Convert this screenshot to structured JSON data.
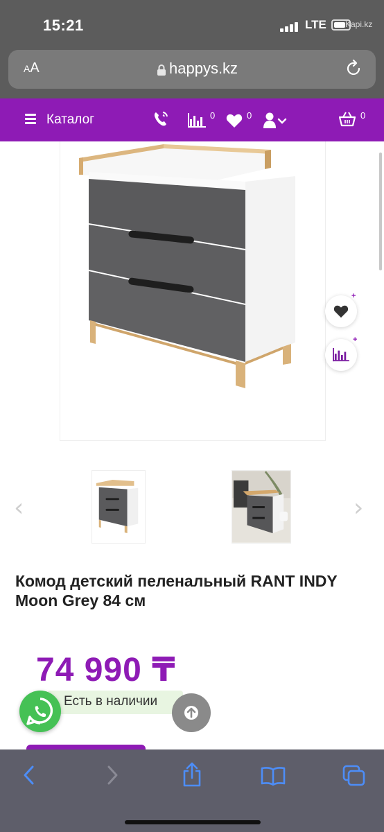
{
  "status_bar": {
    "time": "15:21",
    "network": "LTE",
    "watermark": "Kapi.kz"
  },
  "browser": {
    "text_size_label_small": "A",
    "text_size_label_large": "A",
    "url": "happys.kz"
  },
  "header": {
    "catalog_label": "Каталог",
    "compare_count": "0",
    "wishlist_count": "0",
    "cart_count": "0",
    "accent_color": "#8e1bb5"
  },
  "product": {
    "title": "Комод детский пеленальный RANT INDY Moon Grey 84 см",
    "price": "74 990 ₸",
    "availability": "Есть в наличии",
    "side_actions": {
      "wishlist_plus": "+",
      "compare_plus": "+"
    }
  },
  "gallery": {
    "prev_label": "‹",
    "next_label": "›"
  },
  "icons": [
    "menu-icon",
    "phone-icon",
    "compare-icon",
    "heart-icon",
    "user-icon",
    "cart-icon",
    "whatsapp-icon",
    "arrow-up-icon",
    "back-icon",
    "forward-icon",
    "share-icon",
    "bookmarks-icon",
    "tabs-icon",
    "lock-icon",
    "reload-icon"
  ]
}
